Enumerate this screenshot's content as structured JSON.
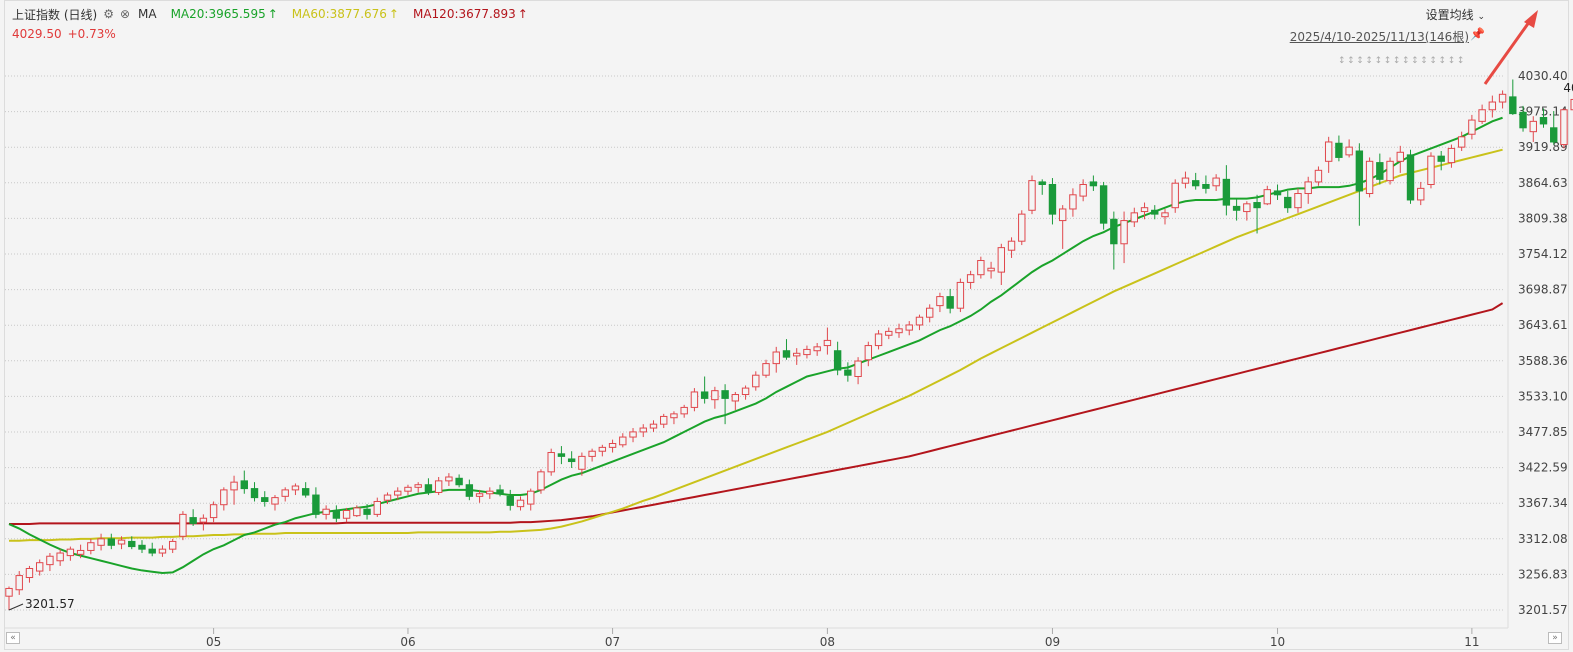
{
  "header": {
    "title": "上证指数 (日线)",
    "ma_label": "MA",
    "ma_items": [
      {
        "text": "MA20:3965.595",
        "color": "#1aa32a"
      },
      {
        "text": "MA60:3877.676",
        "color": "#c9c21a"
      },
      {
        "text": "MA120:3677.893",
        "color": "#b3151c"
      }
    ],
    "price": "4029.50",
    "change": "+0.73%",
    "settings_label": "设置均线",
    "range_label": "2025/4/10-2025/11/13(146根)",
    "settings_icon": "gear-icon",
    "close_icon": "close-icon",
    "pin_icon": "pin-icon"
  },
  "chart_data": {
    "type": "candlestick",
    "y_ticks": [
      "4030.40",
      "3975.14",
      "3919.89",
      "3864.63",
      "3809.38",
      "3754.12",
      "3698.87",
      "3643.61",
      "3588.36",
      "3533.10",
      "3477.85",
      "3422.59",
      "3367.34",
      "3312.08",
      "3256.83",
      "3201.57"
    ],
    "ylim": [
      3201.57,
      4030.4
    ],
    "x_ticks": [
      "05",
      "06",
      "07",
      "08",
      "09",
      "10",
      "11"
    ],
    "x_tick_index": [
      20,
      39,
      59,
      80,
      102,
      124,
      143
    ],
    "high_label": "4030.40",
    "low_label": "3201.57",
    "colors": {
      "up": "#e0474c",
      "down": "#1a9a3a",
      "ma20": "#1aa32a",
      "ma60": "#c9c21a",
      "ma120": "#b3151c"
    },
    "ohlc": [
      [
        3223,
        3238,
        3201.57,
        3235
      ],
      [
        3233,
        3262,
        3225,
        3255
      ],
      [
        3252,
        3270,
        3244,
        3266
      ],
      [
        3262,
        3280,
        3255,
        3275
      ],
      [
        3272,
        3290,
        3262,
        3285
      ],
      [
        3278,
        3296,
        3270,
        3290
      ],
      [
        3286,
        3300,
        3278,
        3296
      ],
      [
        3288,
        3303,
        3282,
        3294
      ],
      [
        3294,
        3312,
        3288,
        3306
      ],
      [
        3302,
        3320,
        3294,
        3312
      ],
      [
        3312,
        3320,
        3296,
        3302
      ],
      [
        3304,
        3316,
        3296,
        3310
      ],
      [
        3308,
        3316,
        3296,
        3300
      ],
      [
        3302,
        3310,
        3290,
        3296
      ],
      [
        3296,
        3306,
        3285,
        3290
      ],
      [
        3290,
        3302,
        3284,
        3296
      ],
      [
        3296,
        3312,
        3290,
        3308
      ],
      [
        3316,
        3355,
        3310,
        3350
      ],
      [
        3345,
        3358,
        3332,
        3336
      ],
      [
        3338,
        3350,
        3325,
        3344
      ],
      [
        3345,
        3370,
        3338,
        3365
      ],
      [
        3365,
        3392,
        3356,
        3388
      ],
      [
        3388,
        3410,
        3365,
        3400
      ],
      [
        3402,
        3418,
        3382,
        3390
      ],
      [
        3390,
        3400,
        3370,
        3376
      ],
      [
        3376,
        3386,
        3362,
        3370
      ],
      [
        3366,
        3380,
        3356,
        3376
      ],
      [
        3378,
        3392,
        3370,
        3388
      ],
      [
        3388,
        3398,
        3380,
        3394
      ],
      [
        3390,
        3400,
        3376,
        3380
      ],
      [
        3380,
        3392,
        3344,
        3350
      ],
      [
        3350,
        3364,
        3342,
        3358
      ],
      [
        3356,
        3364,
        3338,
        3344
      ],
      [
        3344,
        3360,
        3338,
        3356
      ],
      [
        3348,
        3364,
        3346,
        3360
      ],
      [
        3358,
        3366,
        3342,
        3350
      ],
      [
        3350,
        3376,
        3346,
        3370
      ],
      [
        3372,
        3384,
        3366,
        3380
      ],
      [
        3380,
        3392,
        3372,
        3386
      ],
      [
        3386,
        3396,
        3380,
        3392
      ],
      [
        3392,
        3400,
        3384,
        3396
      ],
      [
        3396,
        3406,
        3380,
        3384
      ],
      [
        3384,
        3408,
        3380,
        3402
      ],
      [
        3402,
        3414,
        3394,
        3408
      ],
      [
        3406,
        3412,
        3392,
        3396
      ],
      [
        3396,
        3404,
        3372,
        3378
      ],
      [
        3378,
        3388,
        3368,
        3382
      ],
      [
        3382,
        3392,
        3374,
        3386
      ],
      [
        3388,
        3396,
        3378,
        3382
      ],
      [
        3378,
        3388,
        3356,
        3364
      ],
      [
        3362,
        3378,
        3356,
        3372
      ],
      [
        3366,
        3390,
        3356,
        3386
      ],
      [
        3388,
        3420,
        3382,
        3416
      ],
      [
        3416,
        3452,
        3410,
        3446
      ],
      [
        3444,
        3456,
        3428,
        3440
      ],
      [
        3436,
        3448,
        3422,
        3432
      ],
      [
        3420,
        3446,
        3410,
        3440
      ],
      [
        3440,
        3452,
        3432,
        3448
      ],
      [
        3448,
        3458,
        3440,
        3454
      ],
      [
        3454,
        3466,
        3446,
        3460
      ],
      [
        3458,
        3476,
        3454,
        3470
      ],
      [
        3470,
        3484,
        3462,
        3478
      ],
      [
        3478,
        3490,
        3470,
        3484
      ],
      [
        3484,
        3496,
        3478,
        3490
      ],
      [
        3490,
        3506,
        3484,
        3502
      ],
      [
        3500,
        3510,
        3490,
        3506
      ],
      [
        3506,
        3520,
        3500,
        3516
      ],
      [
        3516,
        3546,
        3510,
        3540
      ],
      [
        3540,
        3564,
        3522,
        3530
      ],
      [
        3528,
        3548,
        3514,
        3542
      ],
      [
        3542,
        3552,
        3490,
        3530
      ],
      [
        3526,
        3540,
        3512,
        3536
      ],
      [
        3536,
        3550,
        3528,
        3546
      ],
      [
        3548,
        3572,
        3542,
        3566
      ],
      [
        3566,
        3590,
        3562,
        3584
      ],
      [
        3584,
        3610,
        3570,
        3602
      ],
      [
        3604,
        3622,
        3590,
        3594
      ],
      [
        3596,
        3608,
        3582,
        3600
      ],
      [
        3598,
        3612,
        3592,
        3606
      ],
      [
        3604,
        3616,
        3596,
        3610
      ],
      [
        3612,
        3640,
        3598,
        3620
      ],
      [
        3604,
        3618,
        3566,
        3574
      ],
      [
        3574,
        3586,
        3556,
        3566
      ],
      [
        3564,
        3594,
        3552,
        3588
      ],
      [
        3590,
        3618,
        3580,
        3612
      ],
      [
        3612,
        3636,
        3606,
        3630
      ],
      [
        3628,
        3640,
        3622,
        3634
      ],
      [
        3632,
        3646,
        3624,
        3638
      ],
      [
        3636,
        3650,
        3628,
        3644
      ],
      [
        3644,
        3660,
        3636,
        3656
      ],
      [
        3656,
        3676,
        3648,
        3670
      ],
      [
        3674,
        3694,
        3664,
        3688
      ],
      [
        3688,
        3700,
        3662,
        3670
      ],
      [
        3670,
        3716,
        3664,
        3710
      ],
      [
        3710,
        3728,
        3700,
        3722
      ],
      [
        3722,
        3750,
        3716,
        3744
      ],
      [
        3728,
        3742,
        3716,
        3732
      ],
      [
        3726,
        3770,
        3706,
        3764
      ],
      [
        3760,
        3780,
        3748,
        3774
      ],
      [
        3774,
        3822,
        3768,
        3816
      ],
      [
        3822,
        3876,
        3816,
        3868
      ],
      [
        3866,
        3870,
        3846,
        3862
      ],
      [
        3862,
        3872,
        3800,
        3816
      ],
      [
        3806,
        3830,
        3762,
        3824
      ],
      [
        3824,
        3856,
        3812,
        3846
      ],
      [
        3844,
        3870,
        3836,
        3862
      ],
      [
        3866,
        3876,
        3852,
        3860
      ],
      [
        3860,
        3866,
        3792,
        3802
      ],
      [
        3808,
        3820,
        3730,
        3770
      ],
      [
        3770,
        3820,
        3740,
        3806
      ],
      [
        3804,
        3826,
        3796,
        3818
      ],
      [
        3820,
        3834,
        3808,
        3826
      ],
      [
        3822,
        3830,
        3808,
        3816
      ],
      [
        3812,
        3824,
        3800,
        3818
      ],
      [
        3826,
        3870,
        3818,
        3864
      ],
      [
        3864,
        3882,
        3856,
        3872
      ],
      [
        3868,
        3880,
        3854,
        3860
      ],
      [
        3862,
        3876,
        3848,
        3856
      ],
      [
        3860,
        3878,
        3852,
        3872
      ],
      [
        3870,
        3892,
        3814,
        3830
      ],
      [
        3828,
        3840,
        3806,
        3822
      ],
      [
        3820,
        3836,
        3806,
        3832
      ],
      [
        3834,
        3846,
        3786,
        3826
      ],
      [
        3832,
        3860,
        3830,
        3854
      ],
      [
        3852,
        3862,
        3838,
        3846
      ],
      [
        3842,
        3852,
        3818,
        3826
      ],
      [
        3826,
        3856,
        3818,
        3848
      ],
      [
        3848,
        3874,
        3832,
        3866
      ],
      [
        3866,
        3890,
        3860,
        3884
      ],
      [
        3898,
        3936,
        3880,
        3928
      ],
      [
        3926,
        3938,
        3898,
        3904
      ],
      [
        3908,
        3932,
        3904,
        3920
      ],
      [
        3914,
        3926,
        3798,
        3852
      ],
      [
        3848,
        3904,
        3842,
        3898
      ],
      [
        3896,
        3910,
        3862,
        3870
      ],
      [
        3868,
        3904,
        3862,
        3898
      ],
      [
        3898,
        3922,
        3880,
        3912
      ],
      [
        3908,
        3916,
        3832,
        3838
      ],
      [
        3838,
        3866,
        3830,
        3856
      ],
      [
        3862,
        3912,
        3856,
        3906
      ],
      [
        3906,
        3914,
        3884,
        3898
      ],
      [
        3896,
        3924,
        3888,
        3918
      ],
      [
        3920,
        3944,
        3914,
        3936
      ],
      [
        3940,
        3970,
        3932,
        3962
      ],
      [
        3960,
        3986,
        3956,
        3978
      ],
      [
        3978,
        4000,
        3966,
        3990
      ],
      [
        3990,
        4008,
        3980,
        4002
      ],
      [
        3998,
        4025,
        3970,
        3972
      ],
      [
        3974,
        3984,
        3944,
        3950
      ],
      [
        3944,
        3968,
        3928,
        3960
      ],
      [
        3966,
        3980,
        3950,
        3956
      ],
      [
        3950,
        3976,
        3924,
        3928
      ],
      [
        3924,
        3980,
        3918,
        3978
      ],
      [
        3978,
        4000,
        3970,
        3994
      ],
      [
        3990,
        4008,
        3984,
        3998
      ],
      [
        4000,
        4012,
        3988,
        4010
      ],
      [
        4008,
        4024,
        3994,
        4000
      ],
      [
        3984,
        4010,
        3974,
        3996
      ],
      [
        4000,
        4030.4,
        3994,
        4029.5
      ]
    ],
    "ma20": [
      3335,
      3328,
      3319,
      3311,
      3303,
      3296,
      3290,
      3286,
      3282,
      3278,
      3274,
      3270,
      3266,
      3263,
      3261,
      3259,
      3260,
      3268,
      3278,
      3288,
      3296,
      3302,
      3310,
      3318,
      3322,
      3328,
      3334,
      3338,
      3344,
      3348,
      3352,
      3354,
      3356,
      3358,
      3360,
      3362,
      3366,
      3370,
      3374,
      3378,
      3382,
      3384,
      3386,
      3388,
      3388,
      3388,
      3386,
      3384,
      3382,
      3380,
      3380,
      3382,
      3388,
      3396,
      3404,
      3410,
      3414,
      3420,
      3426,
      3432,
      3438,
      3444,
      3450,
      3456,
      3462,
      3470,
      3478,
      3486,
      3494,
      3500,
      3504,
      3510,
      3516,
      3522,
      3530,
      3540,
      3548,
      3556,
      3564,
      3568,
      3572,
      3576,
      3578,
      3584,
      3590,
      3596,
      3602,
      3608,
      3614,
      3620,
      3628,
      3636,
      3642,
      3650,
      3658,
      3668,
      3680,
      3690,
      3702,
      3714,
      3726,
      3736,
      3744,
      3754,
      3764,
      3774,
      3782,
      3788,
      3796,
      3802,
      3808,
      3814,
      3820,
      3826,
      3832,
      3836,
      3838,
      3838,
      3838,
      3840,
      3840,
      3840,
      3842,
      3846,
      3850,
      3854,
      3856,
      3856,
      3858,
      3858,
      3858,
      3860,
      3864,
      3870,
      3878,
      3888,
      3898,
      3906,
      3912,
      3918,
      3924,
      3930,
      3936,
      3944,
      3952,
      3960,
      3965.595
    ],
    "ma60": [
      3309,
      3309,
      3310,
      3310,
      3310,
      3311,
      3311,
      3312,
      3312,
      3313,
      3313,
      3313,
      3314,
      3314,
      3314,
      3315,
      3315,
      3316,
      3316,
      3317,
      3318,
      3318,
      3319,
      3319,
      3320,
      3320,
      3320,
      3321,
      3321,
      3321,
      3321,
      3321,
      3321,
      3321,
      3321,
      3321,
      3321,
      3321,
      3321,
      3321,
      3322,
      3322,
      3322,
      3322,
      3322,
      3322,
      3322,
      3322,
      3323,
      3323,
      3324,
      3325,
      3326,
      3328,
      3331,
      3335,
      3339,
      3344,
      3349,
      3354,
      3359,
      3365,
      3371,
      3376,
      3382,
      3388,
      3394,
      3400,
      3406,
      3412,
      3418,
      3424,
      3430,
      3436,
      3442,
      3448,
      3454,
      3460,
      3466,
      3472,
      3478,
      3485,
      3492,
      3499,
      3506,
      3513,
      3520,
      3527,
      3534,
      3542,
      3550,
      3558,
      3566,
      3574,
      3583,
      3592,
      3600,
      3608,
      3616,
      3624,
      3632,
      3640,
      3648,
      3656,
      3664,
      3672,
      3680,
      3688,
      3696,
      3703,
      3710,
      3717,
      3724,
      3731,
      3738,
      3745,
      3752,
      3759,
      3766,
      3773,
      3780,
      3786,
      3792,
      3798,
      3804,
      3810,
      3816,
      3822,
      3828,
      3834,
      3840,
      3846,
      3852,
      3858,
      3864,
      3870,
      3876,
      3880,
      3884,
      3888,
      3892,
      3896,
      3900,
      3904,
      3908,
      3912,
      3877.676
    ],
    "ma120": [
      3335,
      3335,
      3335,
      3336,
      3336,
      3336,
      3336,
      3336,
      3336,
      3336,
      3336,
      3336,
      3336,
      3336,
      3336,
      3336,
      3336,
      3336,
      3336,
      3336,
      3336,
      3336,
      3336,
      3336,
      3336,
      3336,
      3336,
      3336,
      3336,
      3336,
      3336,
      3336,
      3336,
      3337,
      3337,
      3337,
      3337,
      3337,
      3337,
      3337,
      3337,
      3337,
      3337,
      3337,
      3337,
      3337,
      3337,
      3337,
      3337,
      3337,
      3338,
      3338,
      3339,
      3340,
      3341,
      3343,
      3345,
      3347,
      3350,
      3353,
      3356,
      3359,
      3362,
      3365,
      3368,
      3371,
      3374,
      3377,
      3380,
      3383,
      3386,
      3389,
      3392,
      3395,
      3398,
      3401,
      3404,
      3407,
      3410,
      3413,
      3416,
      3419,
      3422,
      3425,
      3428,
      3431,
      3434,
      3437,
      3440,
      3444,
      3448,
      3452,
      3456,
      3460,
      3464,
      3468,
      3472,
      3476,
      3480,
      3484,
      3488,
      3492,
      3496,
      3500,
      3504,
      3508,
      3512,
      3516,
      3520,
      3524,
      3528,
      3532,
      3536,
      3540,
      3544,
      3548,
      3552,
      3556,
      3560,
      3564,
      3568,
      3572,
      3576,
      3580,
      3584,
      3588,
      3592,
      3596,
      3600,
      3604,
      3608,
      3612,
      3616,
      3620,
      3624,
      3628,
      3632,
      3636,
      3640,
      3644,
      3648,
      3652,
      3656,
      3660,
      3664,
      3668,
      3677.893
    ]
  }
}
